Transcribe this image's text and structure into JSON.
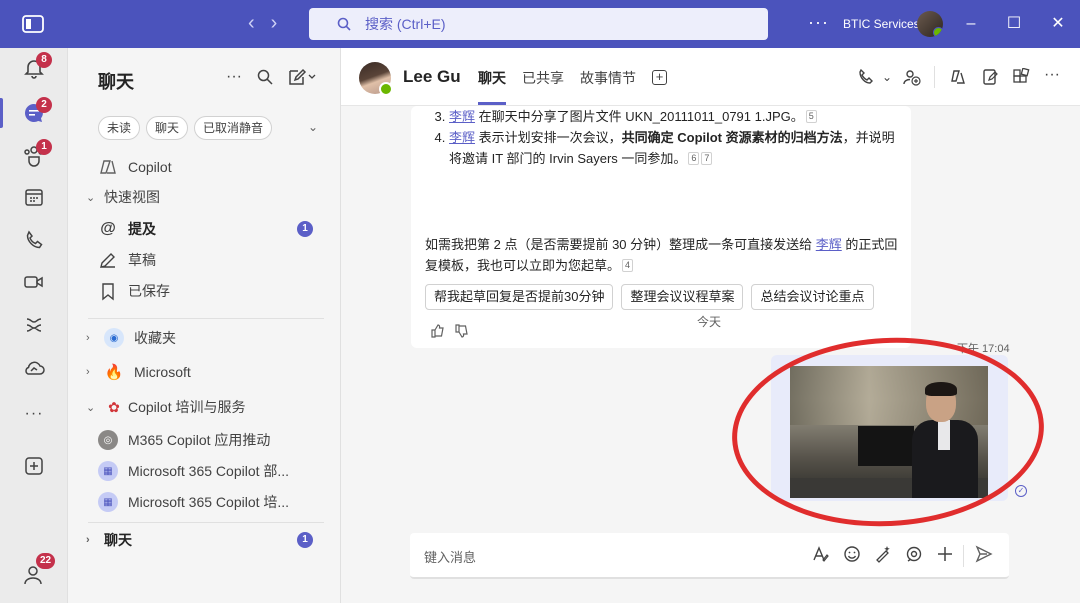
{
  "titlebar": {
    "search_placeholder": "搜索 (Ctrl+E)",
    "more": "···",
    "org_name": "BTIC Services",
    "minimize": "–",
    "maximize": "☐",
    "close": "✕"
  },
  "rail": {
    "activity_badge": "8",
    "chat_badge": "2",
    "teams_badge": "1",
    "more_label": "···",
    "account_badge": "22"
  },
  "sidebar": {
    "title": "聊天",
    "filters": [
      "未读",
      "聊天",
      "已取消静音"
    ],
    "copilot": "Copilot",
    "quick_view": "快速视图",
    "mentions": "提及",
    "mentions_count": "1",
    "drafts": "草稿",
    "saved": "已保存",
    "favorites": "收藏夹",
    "microsoft": "Microsoft",
    "copilot_training": "Copilot 培训与服务",
    "team_items": [
      "M365 Copilot 应用推动",
      "Microsoft 365 Copilot 部...",
      "Microsoft 365 Copilot 培..."
    ],
    "chats": "聊天",
    "chats_count": "1"
  },
  "chat": {
    "contact_name": "Lee Gu",
    "tabs": [
      "聊天",
      "已共享",
      "故事情节"
    ],
    "add_tab": "+"
  },
  "copilot_message": {
    "item3_mention": "李辉",
    "item3_text": " 在聊天中分享了图片文件 UKN_20111011_0791 1.JPG。",
    "item3_cite": "5",
    "item4_mention": "李辉",
    "item4_text_a": " 表示计划安排一次会议，",
    "item4_bold": "共同确定 Copilot 资源素材的归档方法",
    "item4_text_b": "，并说明将邀请 IT 部门的 Irvin Sayers 一同参加。",
    "item4_cite_a": "6",
    "item4_cite_b": "7",
    "para_a": "如需我把第 2 点（是否需要提前 30 分钟）整理成一条可直接发送给 ",
    "para_mention": "李辉",
    "para_b": " 的正式回复模板，我也可以立即为您起草。",
    "para_cite": "4",
    "suggestions": [
      "帮我起草回复是否提前30分钟",
      "整理会议议程草案",
      "总结会议讨论重点"
    ]
  },
  "day_separator": "今天",
  "sent_time": "下午 17:04",
  "compose": {
    "placeholder": "键入消息"
  },
  "colors": {
    "brand": "#4b53bc",
    "accent": "#5b5fc7",
    "highlight_ring": "#e02d2d"
  }
}
